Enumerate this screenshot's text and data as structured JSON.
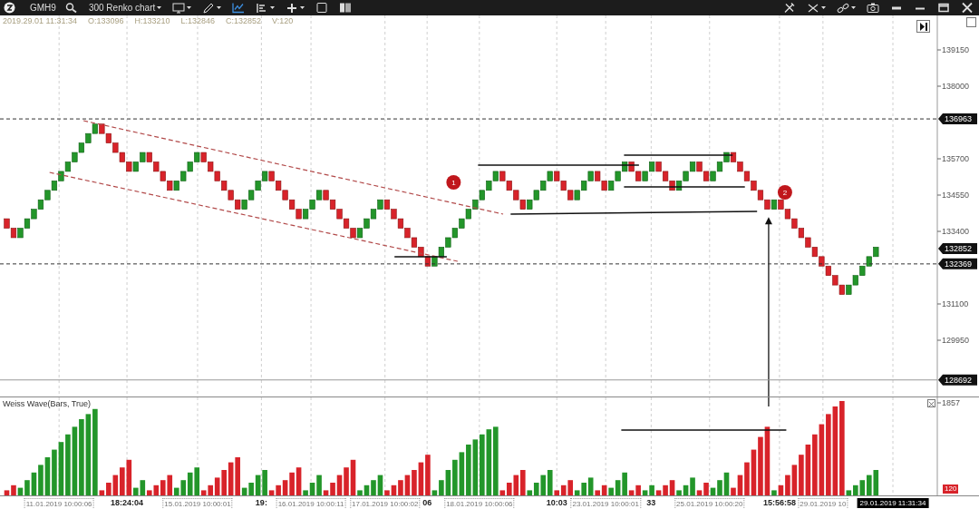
{
  "toolbar": {
    "symbol": "GMH9",
    "chart_type": "300 Renko chart"
  },
  "info": [
    "2019.29.01 11:31:34",
    "O:133096",
    "H:133210",
    "L:132846",
    "C:132852",
    "V:120"
  ],
  "price_panel": {
    "axis_labels": [
      "139150",
      "138000",
      "135700",
      "134550",
      "133400",
      "131100",
      "129950"
    ],
    "price_tags": [
      "136963",
      "132852",
      "132369",
      "128692"
    ],
    "badges": [
      "1",
      "2"
    ]
  },
  "volume_panel": {
    "title": "Weiss Wave(Bars, True)",
    "scale_max": "1857",
    "last_value": "120"
  },
  "time_axis": [
    "11.01.2019 10:00:06",
    "18:24:04",
    "15.01.2019 10:00:01",
    "19:",
    "16.01.2019 10:00:11",
    "17.01.2019 10:00:02",
    "06",
    "18.01.2019 10:00:06",
    "10:03",
    "23.01.2019 10:00:01",
    "33",
    "25.01.2019 10:00:20",
    "15:56:58",
    "29.01.2019 10",
    "29.01.2019 11:31:34"
  ]
}
